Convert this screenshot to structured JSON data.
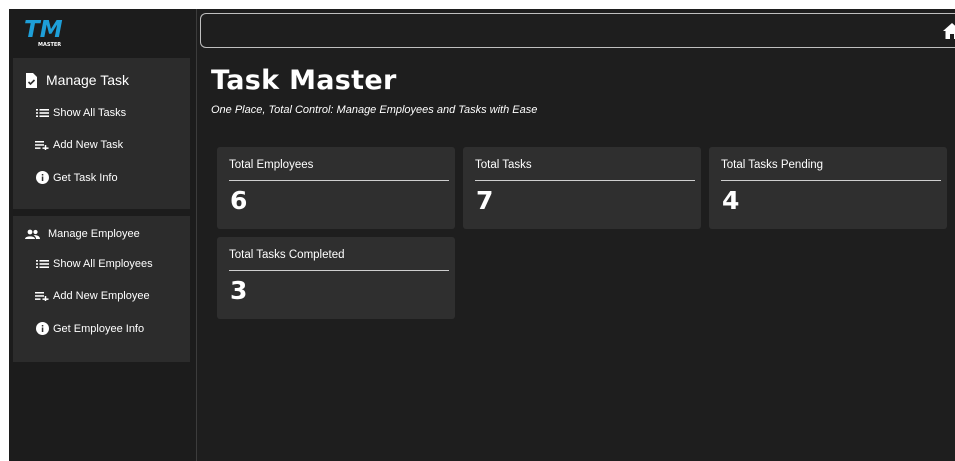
{
  "header": {
    "logo_text": "TM",
    "logo_subtext": "MASTER"
  },
  "sidebar": {
    "task_section": {
      "title": "Manage Task",
      "items": [
        {
          "label": "Show All Tasks",
          "icon": "list-icon"
        },
        {
          "label": "Add New Task",
          "icon": "playlist-add-icon"
        },
        {
          "label": "Get Task Info",
          "icon": "info-icon"
        }
      ]
    },
    "employee_section": {
      "title": "Manage Employee",
      "items": [
        {
          "label": "Show All Employees",
          "icon": "list-icon"
        },
        {
          "label": "Add New Employee",
          "icon": "playlist-add-icon"
        },
        {
          "label": "Get Employee Info",
          "icon": "info-icon"
        }
      ]
    }
  },
  "main": {
    "title": "Task Master",
    "subtitle": "One Place, Total Control: Manage Employees and Tasks with Ease",
    "cards": [
      {
        "label": "Total Employees",
        "value": "6"
      },
      {
        "label": "Total Tasks",
        "value": "7"
      },
      {
        "label": "Total Tasks Pending",
        "value": "4"
      },
      {
        "label": "Total Tasks Completed",
        "value": "3"
      }
    ]
  },
  "colors": {
    "background": "#1e1e1e",
    "panel": "#2c2c2c",
    "card": "#2f2f2f",
    "text": "#ffffff",
    "logo_accent": "#1e9fd8"
  }
}
